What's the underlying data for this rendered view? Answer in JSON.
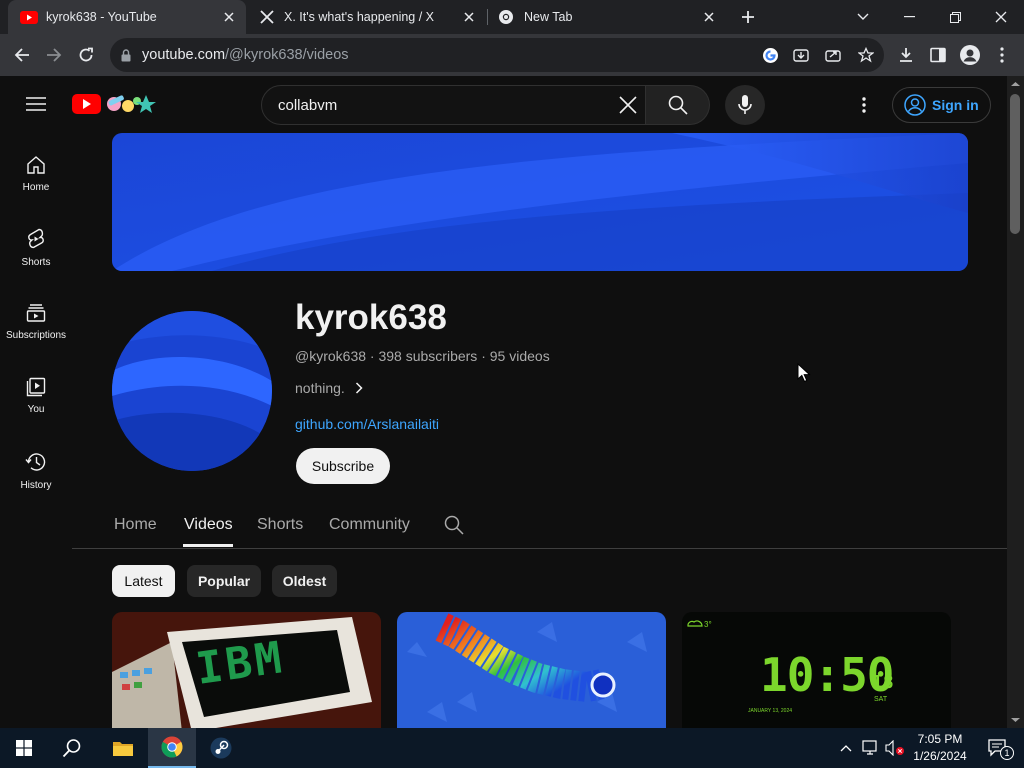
{
  "browser": {
    "tabs": [
      {
        "title": "kyrok638 - YouTube",
        "icon": "youtube-favicon",
        "active": true
      },
      {
        "title": "X. It's what's happening / X",
        "icon": "x-favicon",
        "active": false
      },
      {
        "title": "New Tab",
        "icon": "chrome-favicon",
        "active": false
      }
    ],
    "url_host": "youtube.com",
    "url_path": "/@kyrok638/videos"
  },
  "youtube": {
    "search_value": "collabvm",
    "sign_in": "Sign in",
    "sidebar": [
      {
        "label": "Home",
        "icon": "home-icon"
      },
      {
        "label": "Shorts",
        "icon": "shorts-icon"
      },
      {
        "label": "Subscriptions",
        "icon": "subscriptions-icon"
      },
      {
        "label": "You",
        "icon": "you-icon"
      },
      {
        "label": "History",
        "icon": "history-icon"
      }
    ],
    "channel": {
      "name": "kyrok638",
      "handle": "@kyrok638",
      "subscribers": "398 subscribers",
      "videos": "95 videos",
      "description": "nothing.",
      "link": "github.com/Arslanailaiti",
      "subscribe": "Subscribe"
    },
    "tabs": [
      "Home",
      "Videos",
      "Shorts",
      "Community"
    ],
    "active_tab": "Videos",
    "chips": [
      "Latest",
      "Popular",
      "Oldest"
    ],
    "active_chip": "Latest",
    "thumbnails": [
      {
        "text": "IBM"
      },
      {
        "text": ""
      },
      {
        "clock": "10:50",
        "seconds": "18",
        "day": "SAT",
        "date": "JANUARY 13, 2024",
        "temp": "3°"
      }
    ]
  },
  "taskbar": {
    "time": "7:05 PM",
    "date": "1/26/2024",
    "notification_count": "1"
  },
  "colors": {
    "accent_link": "#3ea6ff",
    "youtube_red": "#ff0000",
    "banner_blue": "#1d4fe0"
  }
}
